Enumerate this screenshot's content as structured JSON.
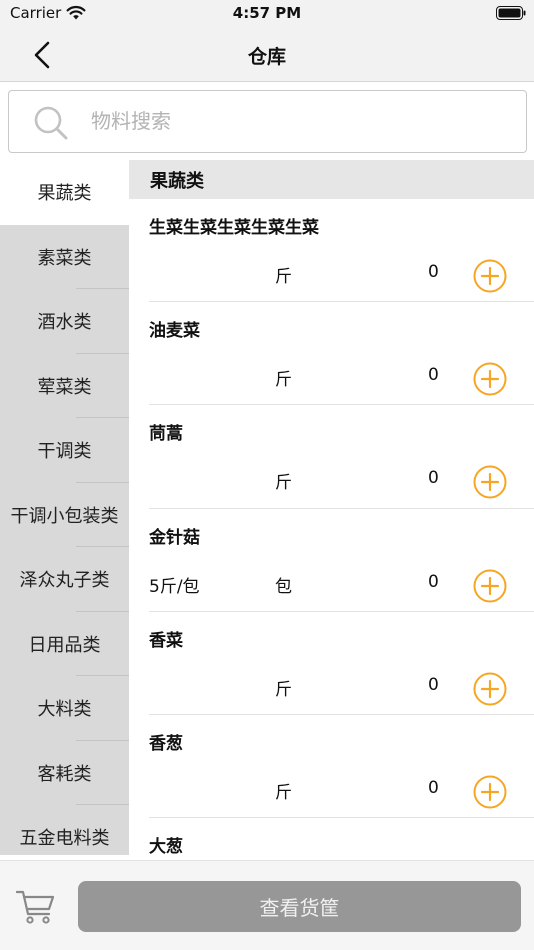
{
  "status_bar": {
    "carrier": "Carrier",
    "time": "4:57 PM"
  },
  "nav": {
    "title": "仓库"
  },
  "search": {
    "placeholder": "物料搜索"
  },
  "sidebar": {
    "items": [
      {
        "label": "果蔬类",
        "active": true
      },
      {
        "label": "素菜类"
      },
      {
        "label": "酒水类"
      },
      {
        "label": "荤菜类"
      },
      {
        "label": "干调类"
      },
      {
        "label": "干调小包装类"
      },
      {
        "label": "泽众丸子类"
      },
      {
        "label": "日用品类"
      },
      {
        "label": "大料类"
      },
      {
        "label": "客耗类"
      },
      {
        "label": "五金电料类"
      }
    ]
  },
  "content": {
    "section_title": "果蔬类",
    "products": [
      {
        "name": "生菜生菜生菜生菜生菜",
        "spec": "",
        "unit": "斤",
        "qty": "0"
      },
      {
        "name": "油麦菜",
        "spec": "",
        "unit": "斤",
        "qty": "0"
      },
      {
        "name": "茼蒿",
        "spec": "",
        "unit": "斤",
        "qty": "0"
      },
      {
        "name": "金针菇",
        "spec": "5斤/包",
        "unit": "包",
        "qty": "0"
      },
      {
        "name": "香菜",
        "spec": "",
        "unit": "斤",
        "qty": "0"
      },
      {
        "name": "香葱",
        "spec": "",
        "unit": "斤",
        "qty": "0"
      },
      {
        "name": "大葱",
        "spec": "",
        "unit": "",
        "qty": ""
      }
    ]
  },
  "bottom_bar": {
    "view_basket_label": "查看货筐"
  },
  "colors": {
    "accent": "#f5a623",
    "disabled_button": "#979797",
    "sidebar_bg": "#d9d9d9"
  }
}
